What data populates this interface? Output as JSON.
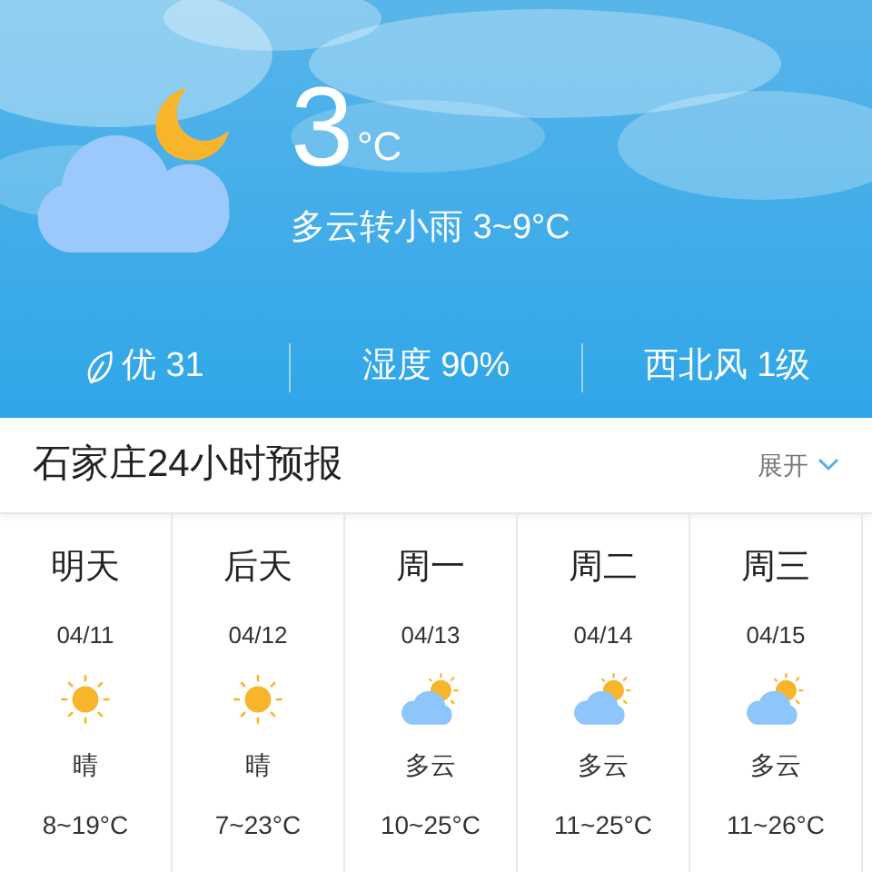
{
  "current": {
    "kind": "night-partly-cloudy",
    "temperature": "3",
    "unit": "°C",
    "summary": "多云转小雨 3~9°C"
  },
  "stats": [
    {
      "kind": "air",
      "text": "优 31"
    },
    {
      "kind": "plain",
      "text": "湿度 90%"
    },
    {
      "kind": "plain",
      "text": "西北风 1级"
    }
  ],
  "forecast": {
    "title": "石家庄24小时预报",
    "toggle": "展开",
    "days": [
      {
        "day": "明天",
        "date": "04/11",
        "kind": "sunny",
        "condition": "晴",
        "range": "8~19°C"
      },
      {
        "day": "后天",
        "date": "04/12",
        "kind": "sunny",
        "condition": "晴",
        "range": "7~23°C"
      },
      {
        "day": "周一",
        "date": "04/13",
        "kind": "partly-cloudy",
        "condition": "多云",
        "range": "10~25°C"
      },
      {
        "day": "周二",
        "date": "04/14",
        "kind": "partly-cloudy",
        "condition": "多云",
        "range": "11~25°C"
      },
      {
        "day": "周三",
        "date": "04/15",
        "kind": "partly-cloudy",
        "condition": "多云",
        "range": "11~26°C"
      }
    ]
  }
}
